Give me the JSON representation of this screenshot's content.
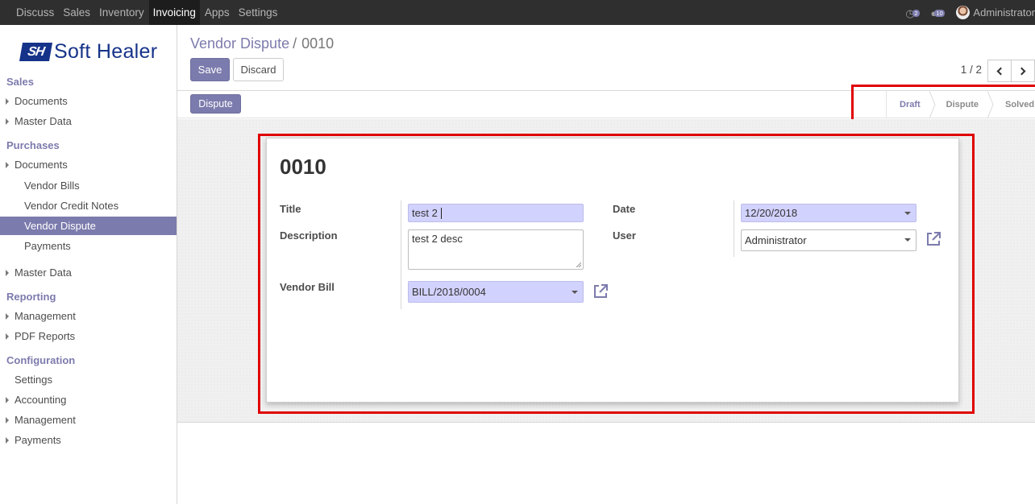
{
  "topbar": {
    "menu": [
      "Discuss",
      "Sales",
      "Inventory",
      "Invoicing",
      "Apps",
      "Settings"
    ],
    "active_index": 3,
    "activity_count": "2",
    "message_count": "10",
    "user_name": "Administrator"
  },
  "sidebar": {
    "logo_mark": "SH",
    "logo_text": "Soft Healer",
    "sections": {
      "sales": "Sales",
      "purchases": "Purchases",
      "reporting": "Reporting",
      "configuration": "Configuration"
    },
    "items": {
      "sales_documents": "Documents",
      "sales_master_data": "Master Data",
      "purchases_documents": "Documents",
      "vendor_bills": "Vendor Bills",
      "vendor_credit_notes": "Vendor Credit Notes",
      "vendor_dispute": "Vendor Dispute",
      "payments": "Payments",
      "purchases_master_data": "Master Data",
      "management": "Management",
      "pdf_reports": "PDF Reports",
      "settings": "Settings",
      "accounting": "Accounting",
      "config_management": "Management",
      "config_payments": "Payments"
    }
  },
  "control_panel": {
    "breadcrumb_parent": "Vendor Dispute",
    "breadcrumb_separator": "/",
    "breadcrumb_current": "0010",
    "save_label": "Save",
    "discard_label": "Discard",
    "pager": "1 / 2"
  },
  "statusbar": {
    "action_button": "Dispute",
    "steps": [
      "Draft",
      "Dispute",
      "Solved"
    ],
    "active_step": "Draft"
  },
  "form": {
    "record_name": "0010",
    "title_label": "Title",
    "title_value": "test 2",
    "description_label": "Description",
    "description_value": "test 2 desc",
    "vendor_bill_label": "Vendor Bill",
    "vendor_bill_value": "BILL/2018/0004",
    "date_label": "Date",
    "date_value": "12/20/2018",
    "user_label": "User",
    "user_value": "Administrator"
  },
  "colors": {
    "accent": "#7c7bad",
    "highlight": "#e00000",
    "required_field": "#d2d2ff",
    "logo": "#16338a"
  }
}
